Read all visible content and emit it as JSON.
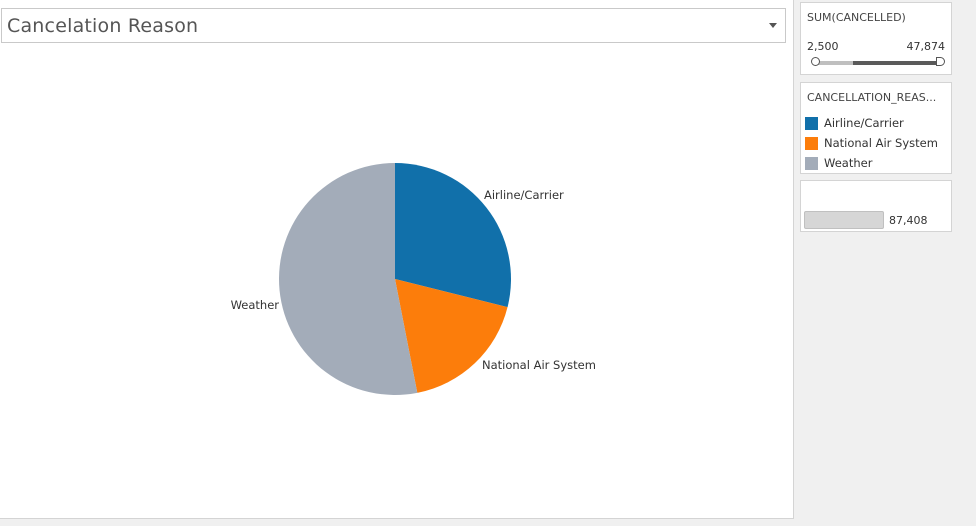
{
  "header": {
    "title": "Cancelation Reason"
  },
  "filter": {
    "title": "SUM(CANCELLED)",
    "min_label": "2,500",
    "max_label": "47,874",
    "selected_min_fraction": 0.3,
    "selected_max_fraction": 1.0
  },
  "legend": {
    "title": "CANCELLATION_REAS...",
    "items": [
      {
        "label": "Airline/Carrier",
        "color": "#1170aa"
      },
      {
        "label": "National Air System",
        "color": "#fc7d0b"
      },
      {
        "label": "Weather",
        "color": "#a3acb9"
      }
    ]
  },
  "parameter": {
    "value": "87,408"
  },
  "chart_data": {
    "type": "pie",
    "title": "",
    "categories": [
      "Airline/Carrier",
      "National Air System",
      "Weather"
    ],
    "values": [
      25262,
      15749,
      46397
    ],
    "colors": [
      "#1170aa",
      "#fc7d0b",
      "#a3acb9"
    ],
    "labels": [
      "Airline/Carrier",
      "National Air System",
      "Weather"
    ],
    "legend_position": "right"
  }
}
